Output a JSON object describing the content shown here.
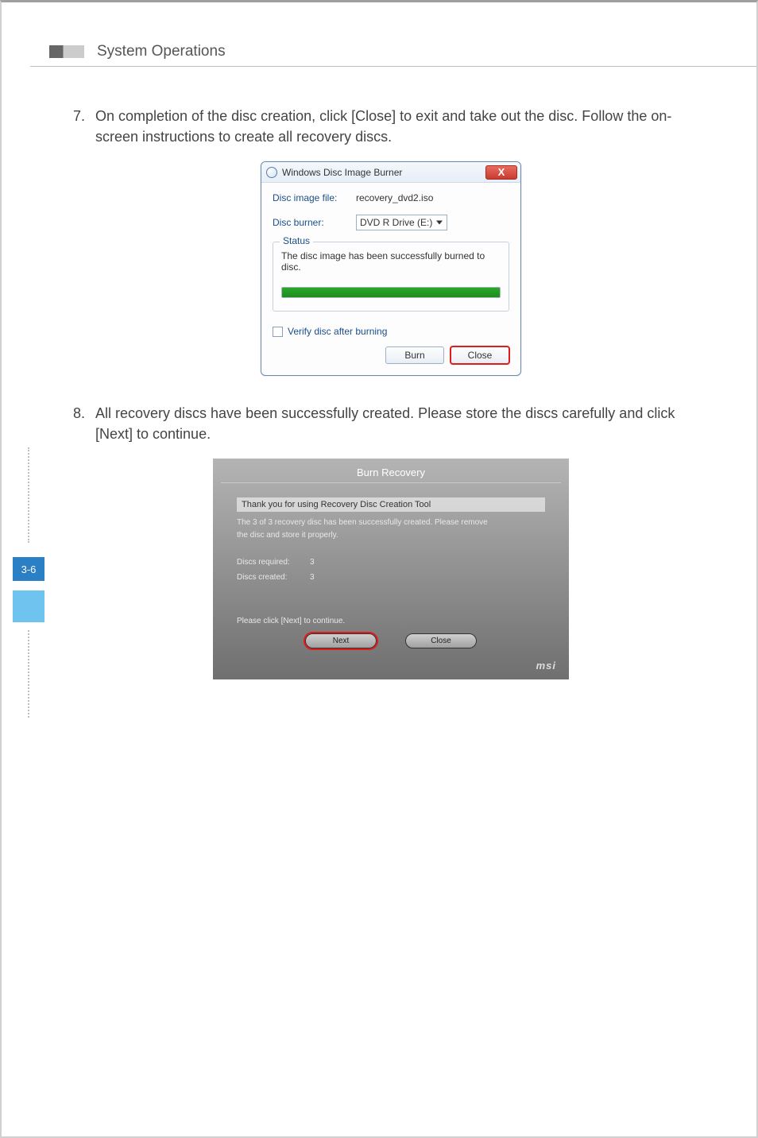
{
  "header": {
    "title": "System Operations"
  },
  "side": {
    "page_label": "3-6"
  },
  "step7": {
    "number": "7.",
    "text": "On completion of the disc creation, click [Close] to exit and take out the disc. Follow the on-screen instructions to create all recovery discs."
  },
  "step8": {
    "number": "8.",
    "text": "All recovery discs have been successfully created. Please store the discs carefully and click [Next] to continue."
  },
  "win_dialog": {
    "title": "Windows Disc Image Burner",
    "close_glyph": "X",
    "disc_image_label": "Disc image file:",
    "disc_image_value": "recovery_dvd2.iso",
    "disc_burner_label": "Disc burner:",
    "disc_burner_value": "DVD R Drive (E:)",
    "status_legend": "Status",
    "status_text": "The disc image has been successfully burned to disc.",
    "verify_label": "Verify disc after burning",
    "burn_label": "Burn",
    "close_label": "Close"
  },
  "br_dialog": {
    "title": "Burn Recovery",
    "heading": "Thank you for using Recovery Disc Creation Tool",
    "line1": "The 3 of 3 recovery disc has been successfully created. Please remove",
    "line2": "the disc and store it properly.",
    "discs_required_label": "Discs required:",
    "discs_required_value": "3",
    "discs_created_label": "Discs created:",
    "discs_created_value": "3",
    "instruction": "Please click [Next] to continue.",
    "next_label": "Next",
    "close_label": "Close",
    "brand": "msi"
  }
}
